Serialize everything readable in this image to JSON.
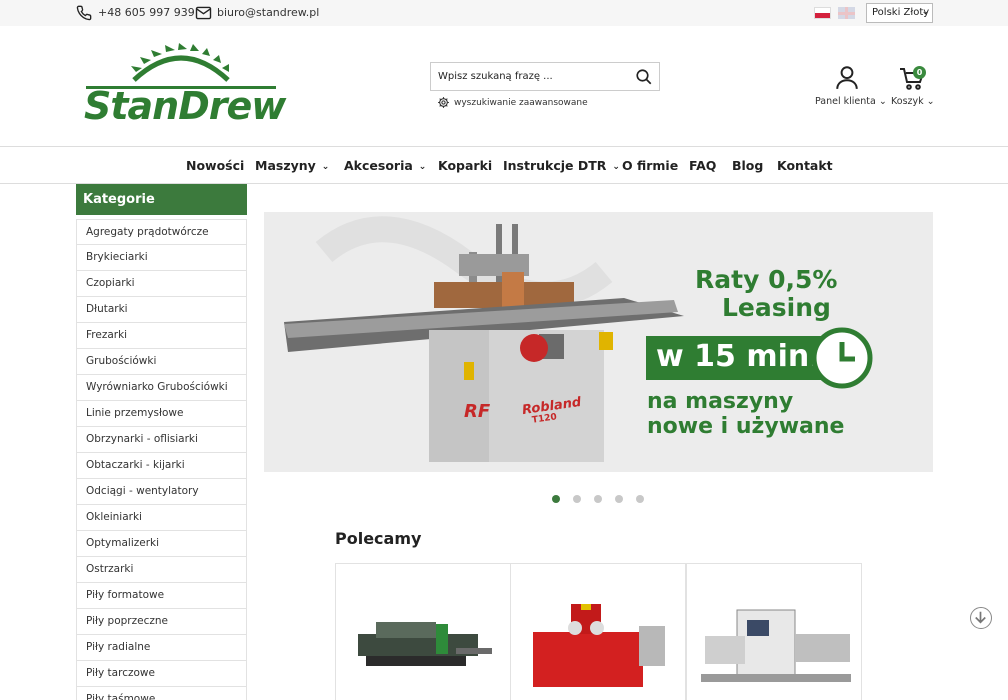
{
  "topbar": {
    "phone": "+48 605 997 939",
    "email": "biuro@standrew.pl",
    "languages": [
      "PL",
      "EN"
    ],
    "currency": "Polski Złoty"
  },
  "header": {
    "logo_text": "StanDrew",
    "search_placeholder": "Wpisz szukaną frazę ...",
    "advanced_search": "wyszukiwanie zaawansowane",
    "user_label": "Panel klienta",
    "cart_label": "Koszyk",
    "cart_count": "0"
  },
  "nav": {
    "items": [
      {
        "label": "Nowości",
        "dropdown": false
      },
      {
        "label": "Maszyny",
        "dropdown": true
      },
      {
        "label": "Akcesoria",
        "dropdown": true
      },
      {
        "label": "Koparki",
        "dropdown": false
      },
      {
        "label": "Instrukcje DTR",
        "dropdown": true
      },
      {
        "label": "O firmie",
        "dropdown": false
      },
      {
        "label": "FAQ",
        "dropdown": false
      },
      {
        "label": "Blog",
        "dropdown": false
      },
      {
        "label": "Kontakt",
        "dropdown": false
      }
    ]
  },
  "sidebar": {
    "title": "Kategorie",
    "items": [
      "Agregaty prądotwórcze",
      "Brykieciarki",
      "Czopiarki",
      "Dłutarki",
      "Frezarki",
      "Grubościówki",
      "Wyrówniarko Grubościówki",
      "Linie przemysłowe",
      "Obrzynarki - oflisiarki",
      "Obtaczarki - kijarki",
      "Odciągi - wentylatory",
      "Okleiniarki",
      "Optymalizerki",
      "Ostrzarki",
      "Piły formatowe",
      "Piły poprzeczne",
      "Piły radialne",
      "Piły tarczowe",
      "Piły taśmowe"
    ]
  },
  "banner": {
    "line1": "Raty 0,5%",
    "line2": "Leasing",
    "line3": "w 15 min.",
    "line4": "na maszyny",
    "line5": "nowe i używane",
    "machine_brand": "Robland",
    "machine_model": "T120",
    "slides": 5,
    "active_slide": 1
  },
  "recommended": {
    "title": "Polecamy"
  },
  "colors": {
    "brand_green": "#3c7a3d"
  }
}
